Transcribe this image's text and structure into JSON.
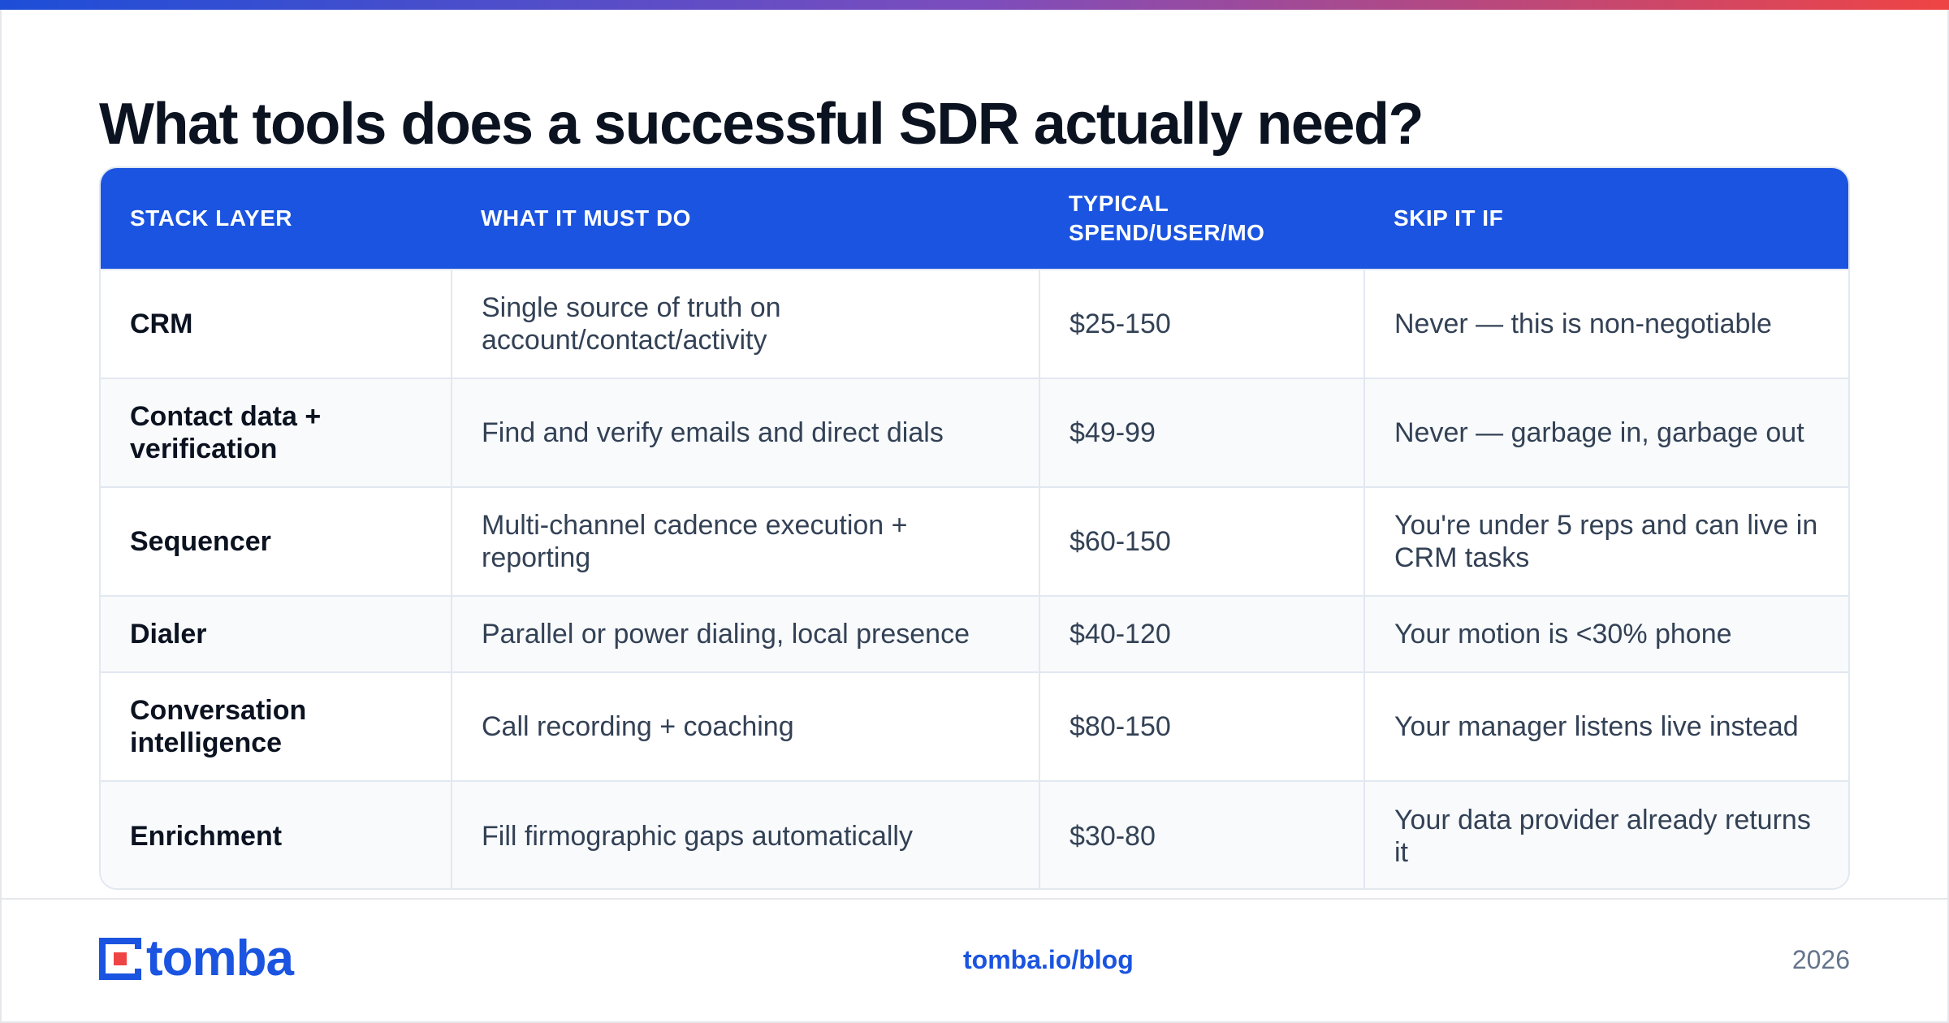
{
  "title": "What tools does a successful SDR actually need?",
  "table": {
    "headers": [
      "STACK LAYER",
      "WHAT IT MUST DO",
      "TYPICAL SPEND/USER/MO",
      "SKIP IT IF"
    ],
    "rows": [
      [
        "CRM",
        "Single source of truth on account/contact/activity",
        "$25-150",
        "Never — this is non-negotiable"
      ],
      [
        "Contact data + verification",
        "Find and verify emails and direct dials",
        "$49-99",
        "Never — garbage in, garbage out"
      ],
      [
        "Sequencer",
        "Multi-channel cadence execution + reporting",
        "$60-150",
        "You're under 5 reps and can live in CRM tasks"
      ],
      [
        "Dialer",
        "Parallel or power dialing, local presence",
        "$40-120",
        "Your motion is <30% phone"
      ],
      [
        "Conversation intelligence",
        "Call recording + coaching",
        "$80-150",
        "Your manager listens live instead"
      ],
      [
        "Enrichment",
        "Fill firmographic gaps automatically",
        "$30-80",
        "Your data provider already returns it"
      ]
    ]
  },
  "footer": {
    "logo_text": "tomba",
    "link": "tomba.io/blog",
    "year": "2026"
  },
  "colors": {
    "brand_blue": "#1a54e0",
    "accent_red": "#ef4444",
    "gradient_start": "#1d4ed8",
    "gradient_end": "#ef4444"
  }
}
